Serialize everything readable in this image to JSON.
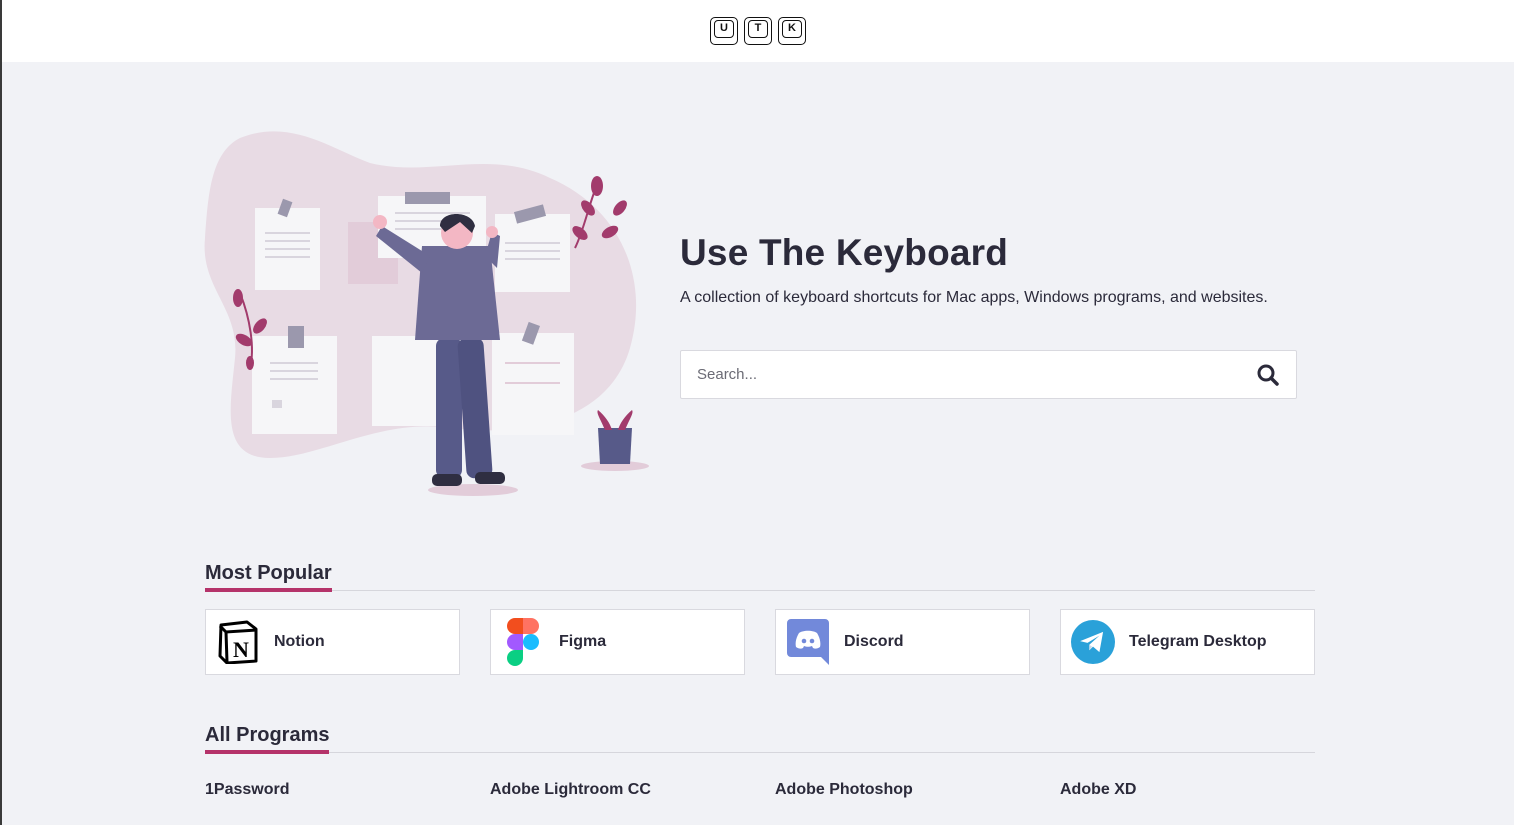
{
  "logo": {
    "keys": [
      "U",
      "T",
      "K"
    ]
  },
  "hero": {
    "title": "Use The Keyboard",
    "subtitle": "A collection of keyboard shortcuts for Mac apps, Windows programs, and websites.",
    "search_placeholder": "Search..."
  },
  "popular": {
    "heading": "Most Popular",
    "items": [
      {
        "label": "Notion",
        "icon": "notion-icon"
      },
      {
        "label": "Figma",
        "icon": "figma-icon"
      },
      {
        "label": "Discord",
        "icon": "discord-icon"
      },
      {
        "label": "Telegram Desktop",
        "icon": "telegram-icon"
      }
    ]
  },
  "all_programs": {
    "heading": "All Programs",
    "items": [
      "1Password",
      "Adobe Lightroom CC",
      "Adobe Photoshop",
      "Adobe XD"
    ]
  },
  "colors": {
    "accent": "#b5336a",
    "background": "#f1f2f6",
    "text": "#2b2a3a"
  }
}
